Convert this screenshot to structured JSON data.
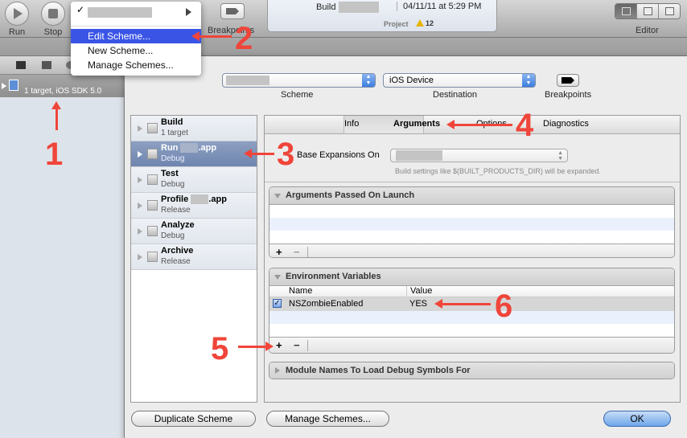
{
  "toolbar": {
    "run_label": "Run",
    "stop_label": "Stop",
    "breakpoints_label": "Breakpoints",
    "editor_label": "Editor",
    "activity": {
      "build_label": "Build",
      "timestamp": "04/11/11 at 5:29 PM",
      "project_label": "Project",
      "warning_count": "12"
    }
  },
  "scheme_menu": {
    "items": [
      {
        "label": "Edit Scheme...",
        "highlighted": true
      },
      {
        "label": "New Scheme..."
      },
      {
        "label": "Manage Schemes..."
      }
    ]
  },
  "sidebar": {
    "project_subtitle": "1 target, iOS SDK 5.0"
  },
  "sheet": {
    "scheme_label": "Scheme",
    "destination_label": "Destination",
    "destination_value": "iOS Device",
    "breakpoints_label": "Breakpoints",
    "actions": [
      {
        "title": "Build",
        "subtitle": "1 target",
        "icon": "hammer-icon"
      },
      {
        "title": "Run",
        "suffix": ".app",
        "subtitle": "Debug",
        "icon": "play-icon",
        "selected": true
      },
      {
        "title": "Test",
        "subtitle": "Debug",
        "icon": "wrench-icon"
      },
      {
        "title": "Profile",
        "suffix": ".app",
        "subtitle": "Release",
        "icon": "wrench-icon"
      },
      {
        "title": "Analyze",
        "subtitle": "Debug",
        "icon": "wrench-icon"
      },
      {
        "title": "Archive",
        "subtitle": "Release",
        "icon": "archive-icon"
      }
    ],
    "tabs": [
      {
        "label": "Info"
      },
      {
        "label": "Arguments",
        "active": true
      },
      {
        "label": "Options"
      },
      {
        "label": "Diagnostics"
      }
    ],
    "base_expansions_label": "Base Expansions On",
    "base_expansions_hint": "Build settings like $(BUILT_PRODUCTS_DIR) will be expanded.",
    "args_group": {
      "title": "Arguments Passed On Launch"
    },
    "env_group": {
      "title": "Environment Variables",
      "columns": [
        "Name",
        "Value"
      ],
      "rows": [
        {
          "enabled": true,
          "name": "NSZombieEnabled",
          "value": "YES"
        }
      ]
    },
    "module_group": {
      "title": "Module Names To Load Debug Symbols For"
    },
    "add_label": "+",
    "remove_label": "−",
    "duplicate_button": "Duplicate Scheme",
    "manage_button": "Manage Schemes...",
    "ok_button": "OK"
  },
  "annotations": [
    "1",
    "2",
    "3",
    "4",
    "5",
    "6"
  ]
}
